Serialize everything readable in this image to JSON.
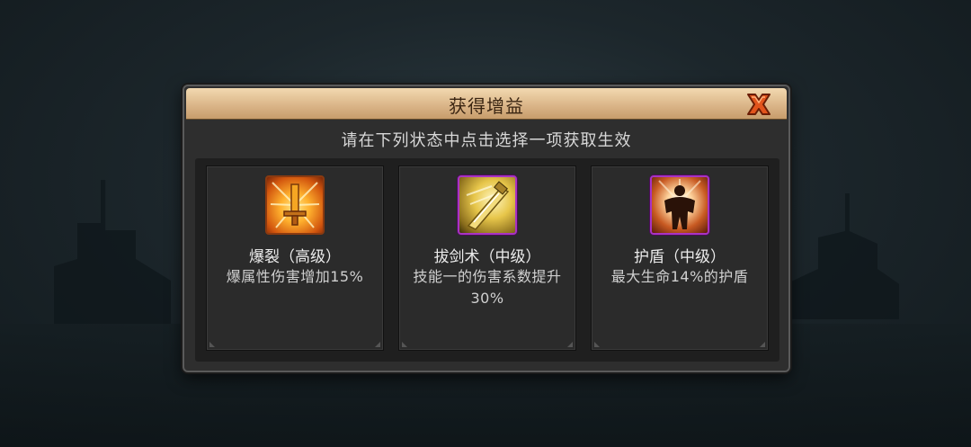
{
  "dialog": {
    "title": "获得增益",
    "subtitle": "请在下列状态中点击选择一项获取生效",
    "close_icon": "close-x-icon"
  },
  "buffs": [
    {
      "name": "爆裂（高级）",
      "description": "爆属性伤害增加15%",
      "icon": "sword-burst-icon",
      "frame_color": "#8a3a10"
    },
    {
      "name": "拔剑术（中级）",
      "description": "技能一的伤害系数提升30%",
      "icon": "sword-draw-icon",
      "frame_color": "#a833c4"
    },
    {
      "name": "护盾（中级）",
      "description": "最大生命14%的护盾",
      "icon": "shield-warrior-icon",
      "frame_color": "#a833c4"
    }
  ],
  "colors": {
    "title_bar": "#d9b386",
    "panel": "#2e2e2e",
    "close_icon": "#e2541c"
  }
}
